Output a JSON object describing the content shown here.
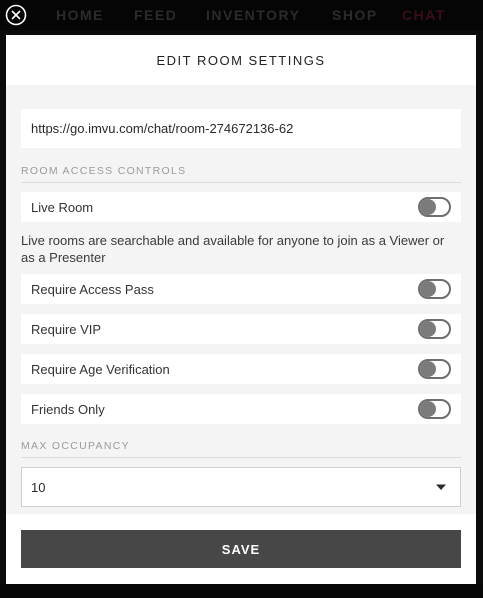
{
  "nav": {
    "items": [
      "HOME",
      "FEED",
      "INVENTORY",
      "SHOP",
      "CHAT"
    ]
  },
  "modal": {
    "title": "EDIT ROOM SETTINGS",
    "room_url": "https://go.imvu.com/chat/room-274672136-62",
    "access_section_label": "ROOM ACCESS CONTROLS",
    "live_room": {
      "label": "Live Room",
      "enabled": false
    },
    "live_description": "Live rooms are searchable and available for anyone to join as a Viewer or as a Presenter",
    "toggles": [
      {
        "label": "Require Access Pass",
        "enabled": false
      },
      {
        "label": "Require VIP",
        "enabled": false
      },
      {
        "label": "Require Age Verification",
        "enabled": false
      },
      {
        "label": "Friends Only",
        "enabled": false
      }
    ],
    "occupancy_section_label": "MAX OCCUPANCY",
    "max_occupancy": "10",
    "save_label": "SAVE"
  },
  "icons": {
    "close": "close-circle-icon",
    "dropdown": "chevron-down-icon"
  },
  "colors": {
    "save_button": "#474747",
    "modal_background": "#f4f4f4",
    "toggle_off": "#7b7b7b"
  }
}
